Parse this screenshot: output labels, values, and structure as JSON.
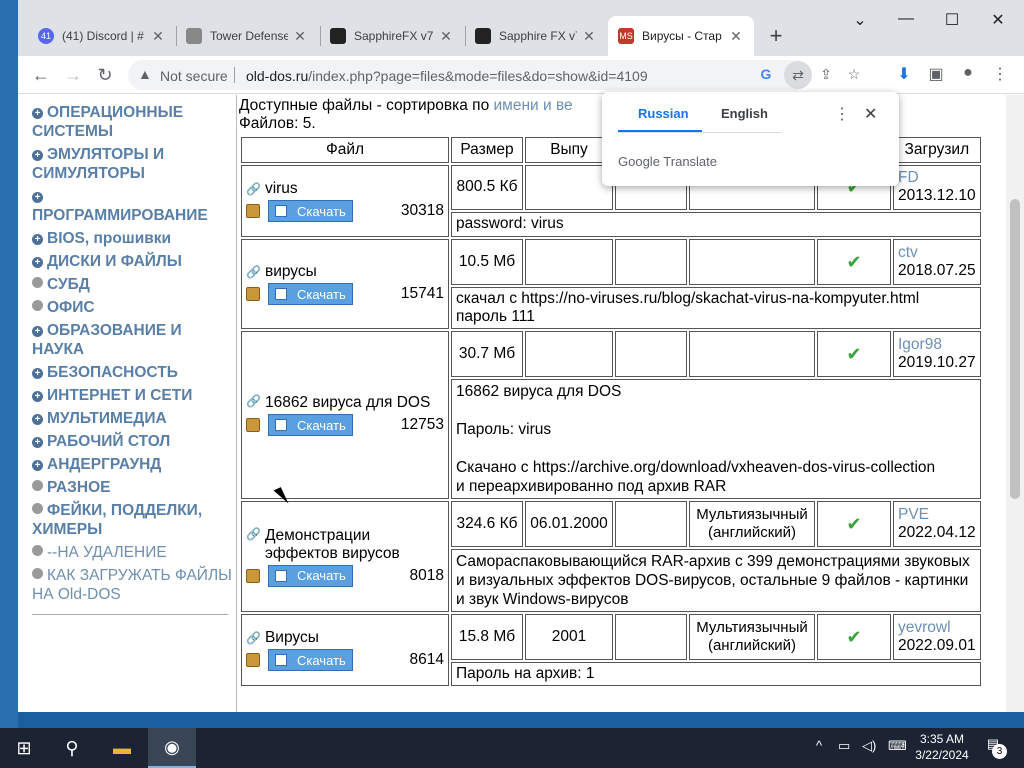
{
  "browser": {
    "tabs": [
      {
        "title": "(41) Discord | #",
        "favicon": "discord",
        "favicon_text": "41",
        "color": "#5865f2"
      },
      {
        "title": "Tower Defense",
        "favicon": "tower",
        "favicon_text": "",
        "color": "#888888"
      },
      {
        "title": "SapphireFX v7.",
        "favicon": "sapphire",
        "favicon_text": "",
        "color": "#222222"
      },
      {
        "title": "Sapphire FX v7",
        "favicon": "sapphire",
        "favicon_text": "",
        "color": "#222222"
      },
      {
        "title": "Вирусы - Стар",
        "favicon": "msdos",
        "favicon_text": "MS",
        "color": "#c0392b"
      }
    ],
    "not_secure": "Not secure",
    "url_domain": "old-dos.ru",
    "url_rest": "/index.php?page=files&mode=files&do=show&id=4109"
  },
  "translate_popup": {
    "lang_from": "Russian",
    "lang_to": "English",
    "brand": "Google Translate"
  },
  "sidebar": {
    "items": [
      {
        "label": "ОПЕРАЦИОННЫЕ СИСТЕМЫ",
        "bullet": "plus",
        "style": "bold"
      },
      {
        "label": "ЭМУЛЯТОРЫ И СИМУЛЯТОРЫ",
        "bullet": "plus",
        "style": "bold"
      },
      {
        "label": "ПРОГРАММИРОВАНИЕ",
        "bullet": "plus",
        "style": "bold"
      },
      {
        "label": "BIOS, прошивки",
        "bullet": "plus",
        "style": "bold"
      },
      {
        "label": "ДИСКИ И ФАЙЛЫ",
        "bullet": "plus",
        "style": "bold"
      },
      {
        "label": "СУБД",
        "bullet": "dot",
        "style": "bold"
      },
      {
        "label": "ОФИС",
        "bullet": "dot",
        "style": "bold"
      },
      {
        "label": "ОБРАЗОВАНИЕ И НАУКА",
        "bullet": "plus",
        "style": "bold"
      },
      {
        "label": "БЕЗОПАСНОСТЬ",
        "bullet": "plus",
        "style": "bold"
      },
      {
        "label": "ИНТЕРНЕТ И СЕТИ",
        "bullet": "plus",
        "style": "bold"
      },
      {
        "label": "МУЛЬТИМЕДИА",
        "bullet": "plus",
        "style": "bold"
      },
      {
        "label": "РАБОЧИЙ СТОЛ",
        "bullet": "plus",
        "style": "bold"
      },
      {
        "label": "АНДЕРГРАУНД",
        "bullet": "plus",
        "style": "bold"
      },
      {
        "label": "РАЗНОЕ",
        "bullet": "dot",
        "style": "bold"
      },
      {
        "label": "ФЕЙКИ, ПОДДЕЛКИ, ХИМЕРЫ",
        "bullet": "dot",
        "style": "bold"
      },
      {
        "label": "--НА УДАЛЕНИЕ",
        "bullet": "dot",
        "style": "light"
      },
      {
        "label": "КАК ЗАГРУЖАТЬ ФАЙЛЫ НА Old-DOS",
        "bullet": "dot",
        "style": "light"
      }
    ]
  },
  "content": {
    "sort_prefix": "Доступные файлы - сортировка по ",
    "sort_link": "имени и ве",
    "count_text": "Файлов: 5.",
    "headers": [
      "Файл",
      "Размер",
      "Выпу",
      "",
      "",
      "во",
      "Загрузил"
    ],
    "download_label": "Скачать",
    "files": [
      {
        "name": "virus",
        "count": "30318",
        "size": "800.5 Кб",
        "release": "",
        "c4": "",
        "lang": "",
        "uploader": "FD",
        "date": "2013.12.10",
        "desc": [
          "password: virus"
        ]
      },
      {
        "name": "вирусы",
        "count": "15741",
        "size": "10.5 Мб",
        "release": "",
        "c4": "",
        "lang": "",
        "uploader": "ctv",
        "date": "2018.07.25",
        "desc": [
          "скачал с https://no-viruses.ru/blog/skachat-virus-na-kompyuter.html",
          "пароль 111"
        ]
      },
      {
        "name": "16862 вируса для DOS",
        "count": "12753",
        "size": "30.7 Мб",
        "release": "",
        "c4": "",
        "lang": "",
        "uploader": "Igor98",
        "date": "2019.10.27",
        "desc": [
          "16862 вируса для DOS",
          "",
          "Пароль: virus",
          "",
          "Скачано с https://archive.org/download/vxheaven-dos-virus-collection",
          "и переархивированно под архив RAR"
        ]
      },
      {
        "name": "Демонстрации эффектов вирусов",
        "count": "8018",
        "size": "324.6 Кб",
        "release": "06.01.2000",
        "c4": "",
        "lang": "Мультиязычный (английский)",
        "uploader": "PVE",
        "date": "2022.04.12",
        "desc": [
          "Самораспаковывающийся RAR-архив с 399 демонстрациями звуковых и визуальных эффектов DOS-вирусов, остальные 9 файлов - картинки и звук Windows-вирусов"
        ]
      },
      {
        "name": "Вирусы",
        "count": "8614",
        "size": "15.8 Мб",
        "release": "2001",
        "c4": "",
        "lang": "Мультиязычный (английский)",
        "uploader": "yevrowl",
        "date": "2022.09.01",
        "desc": [
          "Пароль на архив: 1"
        ]
      }
    ]
  },
  "taskbar": {
    "time": "3:35 AM",
    "date": "3/22/2024",
    "notifications": "3"
  }
}
